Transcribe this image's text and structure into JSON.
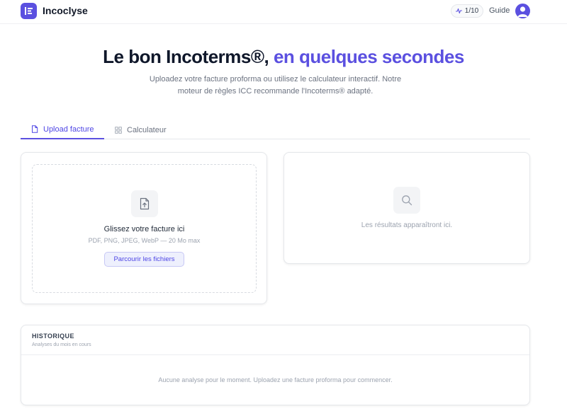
{
  "header": {
    "brand": "Incoclyse",
    "counter": "1/10",
    "guide_label": "Guide"
  },
  "hero": {
    "title_main": "Le bon Incoterms®,",
    "title_accent": "en quelques secondes",
    "subtitle": "Uploadez votre facture proforma ou utilisez le calculateur interactif. Notre moteur de règles ICC recommande l'Incoterms® adapté."
  },
  "tabs": [
    {
      "label": "Upload facture",
      "icon": "document-icon",
      "active": true
    },
    {
      "label": "Calculateur",
      "icon": "grid-icon",
      "active": false
    }
  ],
  "upload": {
    "title": "Glissez votre facture ici",
    "formats": "PDF, PNG, JPEG, WebP — 20 Mo max",
    "browse_label": "Parcourir les fichiers",
    "icon": "file-upload-icon"
  },
  "results": {
    "placeholder": "Les résultats apparaîtront ici.",
    "icon": "search-icon"
  },
  "history": {
    "title": "HISTORIQUE",
    "subtitle": "Analyses du mois en cours",
    "empty": "Aucune analyse pour le moment. Uploadez une facture proforma pour commencer."
  },
  "colors": {
    "accent": "#5b50e0",
    "text": "#0f172a",
    "muted": "#9ca3af"
  }
}
